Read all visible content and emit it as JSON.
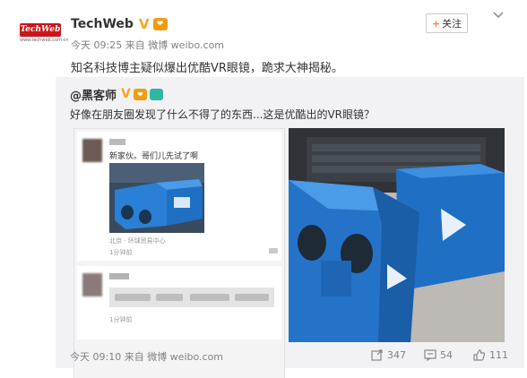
{
  "post": {
    "author": "TechWeb",
    "verified_mark": "V",
    "vip_badge": "❤",
    "logo_text": "TechWeb",
    "logo_sub": "www.techweb.com.cn",
    "meta": "今天 09:25 来自 微博 weibo.com",
    "follow_label": "关注",
    "text": "知名科技博主疑似爆出优酷VR眼镜，跪求大神揭秘。"
  },
  "repost": {
    "author": "@黑客师",
    "verified_mark": "V",
    "text": "好像在朋友圈发现了什么不得了的东西...这是优酷出的VR眼镜？",
    "meta": "今天 09:10 来自 微博 weibo.com",
    "forward_count": "347",
    "comment_count": "54",
    "like_count": "111"
  },
  "screenshot_left": {
    "card1_text": "新家伙。哥们儿先试了啊",
    "card1_location": "北京 · 环球贸易中心",
    "card1_time": "1分钟前",
    "card2_time": "1分钟前"
  },
  "icons": [
    "chevron-down-icon",
    "forward-icon",
    "comment-icon",
    "like-icon",
    "camera-icon"
  ],
  "colors": {
    "accent": "#ff8140",
    "verified": "#f6a623",
    "muted": "#808080",
    "repost_bg": "#f2f2f5",
    "vr_blue": "#1f6fc4"
  }
}
